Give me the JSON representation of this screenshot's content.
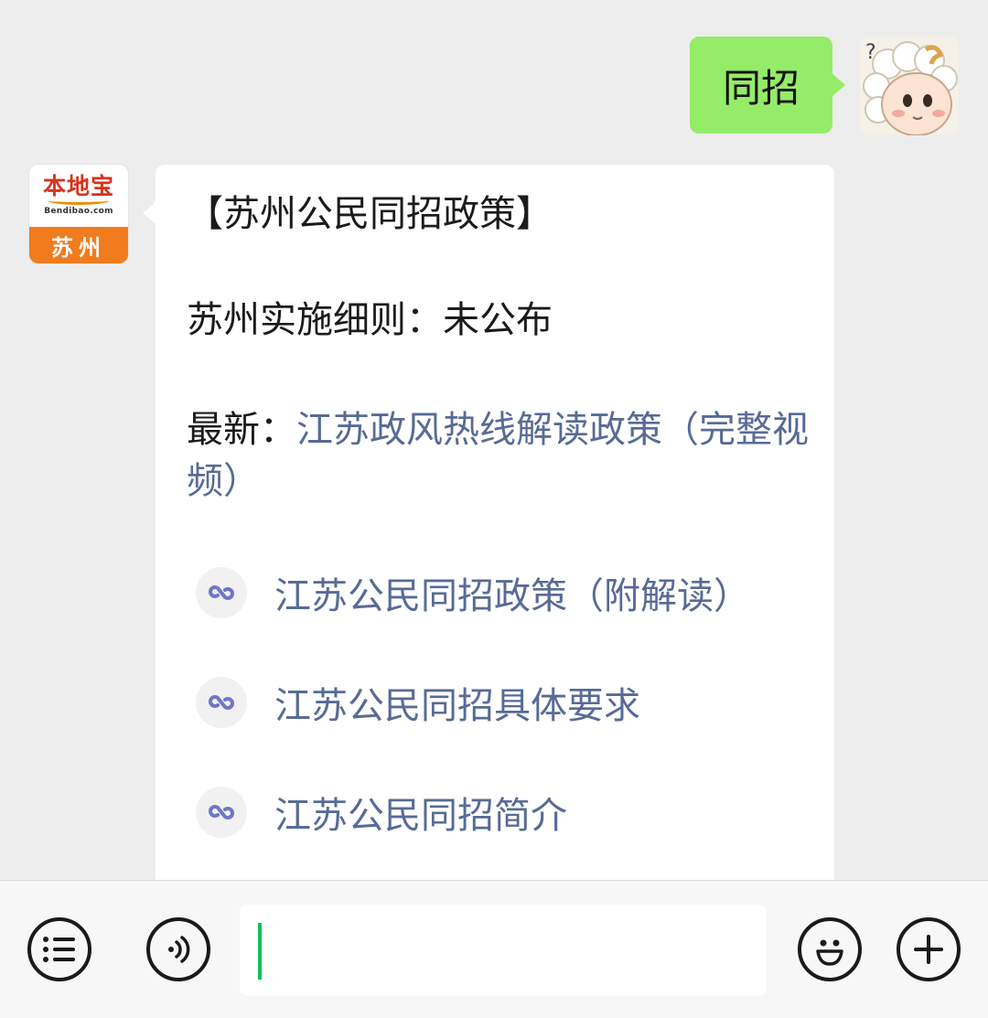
{
  "chat": {
    "sent_message": {
      "text": "同招",
      "avatar": "cartoon-sheep-avatar-icon"
    },
    "received_message": {
      "avatar": {
        "icon": "bendibao-logo-icon",
        "brand": "本地宝",
        "domain": "Bendibao.com",
        "city": "苏州"
      },
      "title": "【苏州公民同招政策】",
      "detail_label": "苏州实施细则：",
      "detail_value": "未公布",
      "latest_label": "最新：",
      "latest_link": "江苏政风热线解读政策（完整视频）",
      "mini_links": [
        {
          "icon": "mini-program-icon",
          "label": "江苏公民同招政策（附解读）"
        },
        {
          "icon": "mini-program-icon",
          "label": "江苏公民同招具体要求"
        },
        {
          "icon": "mini-program-icon",
          "label": "江苏公民同招简介"
        }
      ]
    }
  },
  "input_bar": {
    "menu_icon": "menu-list-icon",
    "voice_icon": "voice-icon",
    "emoji_icon": "emoji-icon",
    "plus_icon": "plus-icon",
    "input_value": "",
    "accent_color": "#07c160"
  },
  "colors": {
    "sent_bubble": "#95ec69",
    "link": "#576b95",
    "background": "#ededed"
  }
}
